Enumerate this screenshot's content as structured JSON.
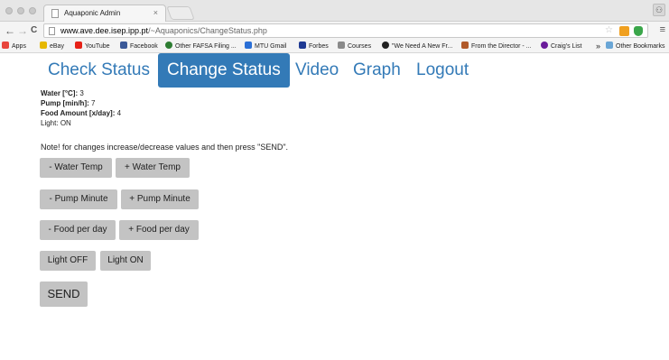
{
  "browser": {
    "tab_title": "Aquaponic Admin",
    "tab_close": "×",
    "url_host": "www.ave.dee.isep.ipp.pt",
    "url_path": "/~Aquaponics/ChangeStatus.php",
    "nav_back": "←",
    "nav_forward": "→",
    "nav_reload": "C",
    "star": "☆",
    "menu": "≡",
    "user": "⚇",
    "bookmarks": [
      {
        "label": "Apps",
        "color": "#e8453c"
      },
      {
        "label": "eBay",
        "color": "#e6b800"
      },
      {
        "label": "YouTube",
        "color": "#e62117"
      },
      {
        "label": "Facebook",
        "color": "#3b5998"
      },
      {
        "label": "Other FAFSA Filing ...",
        "color": "#2e7d32"
      },
      {
        "label": "MTU Gmail",
        "color": "#2a6fd6"
      },
      {
        "label": "Forbes",
        "color": "#1f3a93"
      },
      {
        "label": "Courses",
        "color": "#8a8a8a"
      },
      {
        "label": "\"We Need A New Fr...",
        "color": "#222222"
      },
      {
        "label": "From the Director - ...",
        "color": "#b05a2a"
      },
      {
        "label": "Craig's List",
        "color": "#6a1b9a"
      },
      {
        "label": "»",
        "color": ""
      },
      {
        "label": "Other Bookmarks",
        "color": "#6aa6d6"
      }
    ]
  },
  "nav": {
    "check_status": "Check Status",
    "change_status": "Change Status",
    "video": "Video",
    "graph": "Graph",
    "logout": "Logout"
  },
  "status": {
    "water_label": "Water [°C]:",
    "water_value": "3",
    "pump_label": "Pump [min/h]:",
    "pump_value": "7",
    "food_label": "Food Amount [x/day]:",
    "food_value": "4",
    "light_label": "Light:",
    "light_value": "ON"
  },
  "note": "Note! for changes increase/decrease values and then press \"SEND\".",
  "buttons": {
    "water_down": "- Water Temp",
    "water_up": "+ Water Temp",
    "pump_down": "- Pump Minute",
    "pump_up": "+ Pump Minute",
    "food_down": "- Food per day",
    "food_up": "+ Food per day",
    "light_off": "Light OFF",
    "light_on": "Light ON",
    "send": "SEND"
  },
  "colors": {
    "accent": "#337ab7",
    "button_bg": "#c3c3c3"
  }
}
